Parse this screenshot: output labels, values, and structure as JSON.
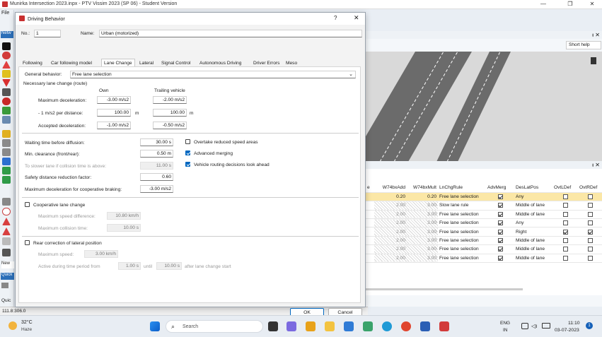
{
  "app": {
    "title": "Munirka Intersection 2023.inpx - PTV Vissim 2023 (SP 06) - Student Version",
    "min": "—",
    "max": "❐",
    "close": "✕"
  },
  "app_menu": {
    "file": "File",
    "netw": "Netw",
    "quick": "Quic",
    "new": "New",
    "quick2": "Quick"
  },
  "right_panel": {
    "short_help": "Short help",
    "pin": "ᵻ",
    "close": "✕"
  },
  "grid": {
    "headers": [
      "e",
      "W74bxAdd",
      "W74bxMult",
      "LnChgRule",
      "AdvMerg",
      "DesLatPos",
      "OvtLDef",
      "OvtRDef"
    ],
    "rows": [
      {
        "add": "0.20",
        "mult": "0.20",
        "rule": "Free lane selection",
        "adv": true,
        "pos": "Any",
        "l": false,
        "r": false,
        "hatch": false,
        "selected": true
      },
      {
        "add": "2.00",
        "mult": "3.00",
        "rule": "Slow lane rule",
        "adv": true,
        "pos": "Middle of lane",
        "l": false,
        "r": false,
        "hatch": true
      },
      {
        "add": "2.00",
        "mult": "3.00",
        "rule": "Free lane selection",
        "adv": true,
        "pos": "Middle of lane",
        "l": false,
        "r": false,
        "hatch": true
      },
      {
        "add": "2.00",
        "mult": "3.00",
        "rule": "Free lane selection",
        "adv": true,
        "pos": "Any",
        "l": false,
        "r": false,
        "hatch": true
      },
      {
        "add": "2.00",
        "mult": "3.00",
        "rule": "Free lane selection",
        "adv": true,
        "pos": "Right",
        "l": true,
        "r": true,
        "hatch": true
      },
      {
        "add": "2.00",
        "mult": "3.00",
        "rule": "Free lane selection",
        "adv": true,
        "pos": "Middle of lane",
        "l": false,
        "r": false,
        "hatch": true
      },
      {
        "add": "2.00",
        "mult": "3.00",
        "rule": "Free lane selection",
        "adv": true,
        "pos": "Middle of lane",
        "l": false,
        "r": false,
        "hatch": true
      },
      {
        "add": "2.00",
        "mult": "3.00",
        "rule": "Free lane selection",
        "adv": true,
        "pos": "Middle of lane",
        "l": false,
        "r": false,
        "hatch": true
      }
    ]
  },
  "status": {
    "coords": "111.8:306.0"
  },
  "dialog": {
    "title": "Driving Behavior",
    "help": "?",
    "close": "✕",
    "no_label": "No.:",
    "no_value": "1",
    "name_label": "Name:",
    "name_value": "Urban (motorized)",
    "tabs": [
      "Following",
      "Car following model",
      "Lane Change",
      "Lateral",
      "Signal Control",
      "Autonomous Driving",
      "Driver Errors",
      "Meso"
    ],
    "general_behavior_label": "General behavior:",
    "general_behavior_value": "Free lane selection",
    "necessary_lc": "Necessary lane change (route)",
    "col_own": "Own",
    "col_trailing": "Trailing vehicle",
    "max_decel_label": "Maximum deceleration:",
    "max_decel_own": "-3.00 m/s2",
    "max_decel_trail": "-2.00 m/s2",
    "per_dist_label": "- 1 m/s2 per distance:",
    "per_dist_own": "100.00",
    "per_dist_trail": "100.00",
    "unit_m": "m",
    "acc_decel_label": "Accepted deceleration:",
    "acc_decel_own": "-1.00 m/s2",
    "acc_decel_trail": "-0.50 m/s2",
    "waiting_label": "Waiting time before diffusion:",
    "waiting_value": "30.00 s",
    "min_clear_label": "Min. clearance (front/rear):",
    "min_clear_value": "0.50 m",
    "slower_lane_label": "To slower lane if collision time is above:",
    "slower_lane_value": "11.00 s",
    "safety_label": "Safety distance reduction factor:",
    "safety_value": "0.60",
    "max_coop_label": "Maximum deceleration for cooperative braking:",
    "max_coop_value": "-3.00 m/s2",
    "overtake_label": "Overtake reduced speed areas",
    "adv_merge_label": "Advanced merging",
    "routing_label": "Vehicle routing decisions look ahead",
    "overtake_checked": false,
    "adv_merge_checked": true,
    "routing_checked": true,
    "coop_lc_label": "Cooperative lane change",
    "max_speed_diff_label": "Maximum speed difference:",
    "max_speed_diff_value": "10.80 km/h",
    "max_coll_label": "Maximum collision time:",
    "max_coll_value": "10.00 s",
    "rear_corr_label": "Rear correction of lateral position",
    "max_speed_label": "Maximum speed:",
    "max_speed_value": "3.00 km/h",
    "active_label": "Active during time period from",
    "active_from": "1.00 s",
    "until_label": "until",
    "active_until": "10.00 s",
    "after_lc_label": "after lane change start",
    "ok": "OK",
    "cancel": "Cancel"
  },
  "taskbar": {
    "temp": "32°C",
    "weather": "Haze",
    "search": "Search",
    "lang1": "ENG",
    "lang2": "IN",
    "time": "11:10",
    "date": "03-07-2023",
    "notif": "1"
  }
}
